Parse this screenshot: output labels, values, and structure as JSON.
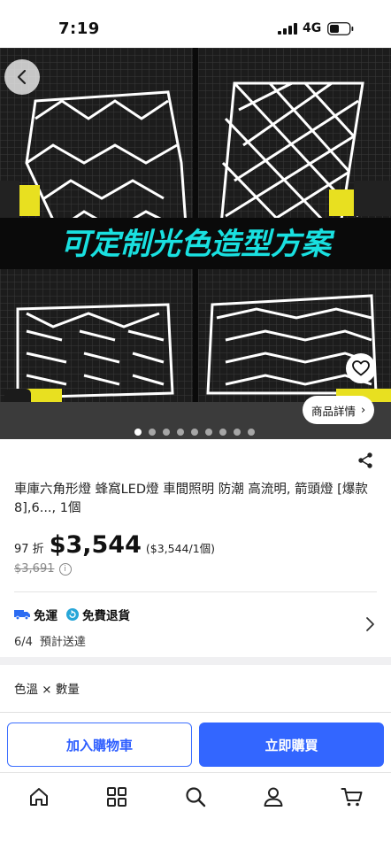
{
  "status_bar": {
    "time": "7:19",
    "network": "4G"
  },
  "hero": {
    "banner_text": "可定制光色造型方案",
    "details_label": "商品詳情",
    "image_count": 9,
    "active_index": 0
  },
  "product": {
    "title": "車庫六角形燈 蜂窩LED燈 車間照明 防潮 高流明, 箭頭燈 [爆款 8],6..., 1個",
    "discount": "97 折",
    "price": "$3,544",
    "unit_price": "($3,544/1個)",
    "original_price": "$3,691",
    "info_glyph": "i"
  },
  "shipping": {
    "free_shipping": "免運",
    "free_returns": "免費退貨",
    "date": "6/4",
    "eta_label": "預計送達"
  },
  "variant": {
    "label": "色溫 × 數量"
  },
  "actions": {
    "add_to_cart": "加入購物車",
    "buy_now": "立即購買"
  },
  "tabbar": {
    "items": [
      "home-icon",
      "categories-icon",
      "search-icon",
      "account-icon",
      "cart-icon"
    ]
  },
  "colors": {
    "accent": "#3366ff",
    "banner_text": "#19e0e0"
  }
}
